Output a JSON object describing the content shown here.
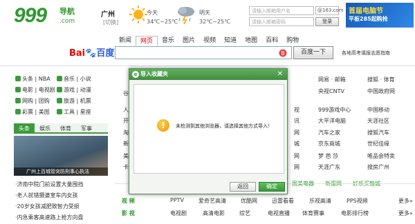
{
  "header": {
    "logo_number": "999",
    "logo_nav": "导航",
    "logo_com": ".com",
    "city": "广州",
    "city_switch": "[切换]",
    "weather": [
      {
        "day": "今天",
        "temp": "34℃~25℃"
      },
      {
        "day": "明天",
        "temp": "32℃~25℃"
      }
    ],
    "mail": {
      "user_placeholder": "请输入邮箱用户名",
      "domain": "@163.com",
      "password_placeholder": "请输入邮箱密码",
      "login_label": "登录"
    },
    "ad": {
      "line1": "首届电脑节",
      "line2": "平板285起购抢"
    }
  },
  "search": {
    "tabs": [
      "新闻",
      "网页",
      "音乐",
      "图片",
      "视频",
      "知道",
      "地图",
      "百科",
      "购物"
    ],
    "active_tab": "网页",
    "engine_bai": "Bai",
    "engine_du": "百度",
    "button_label": "百度一下",
    "side_link": "各地高考填报志愿指南"
  },
  "left": {
    "categories": [
      [
        "头条 | NBA",
        "音乐 | 小说"
      ],
      [
        "电影 | 电视剧",
        "游戏 | 动漫"
      ],
      [
        "网购 | 团购",
        "旅游 | 机票"
      ],
      [
        "彩票 | 美图",
        "工具 | 星座"
      ]
    ],
    "tabs": [
      "头条",
      "娱乐",
      "体育",
      "军事"
    ],
    "image_caption": "广州上百城管突防刑事心执法",
    "news": [
      "·济南中院门前设置大量围挡",
      "·老人就错摄婆室车内女孩",
      "·20岁女孩减肥致智力受损",
      "·内急乘客高速路上抢方向盘"
    ]
  },
  "sites": {
    "row1": [
      "网易 · 邮箱",
      "搜狐 · 体育"
    ],
    "row2": [
      "央视CNTV",
      "中国政府网"
    ],
    "col_a": [
      "999游戏中心",
      "大平洋电脑",
      "汽车之家",
      "京东商城",
      "梦 芭 莎",
      "天涯广东"
    ],
    "col_b": [
      "中国移动",
      "天涯社区",
      "搜狐汽车",
      "世纪佳缘",
      "唯品会特卖",
      "搜房广州"
    ],
    "col_left_edge": [
      "人",
      "开",
      "淘",
      "新",
      "美",
      "卡"
    ],
    "col_mid_edge": [
      "视",
      "讯",
      "网",
      "城",
      "网",
      "网"
    ],
    "strip": [
      "国美电器",
      "新蛋网",
      "好乐买鞋城"
    ],
    "video_row": {
      "label": "视  频",
      "items": [
        "PPTV",
        "爱奇艺高清",
        "优酷网",
        "迅雷看看",
        "乐视高清",
        "PPS视频"
      ],
      "more": "更多»"
    },
    "film_row": {
      "label": "影  视",
      "items": [
        "电视剧",
        "高清电影",
        "综艺",
        "电视直播",
        "体育赛事",
        "电影排行榜"
      ],
      "more": "更多»"
    }
  },
  "dialog": {
    "title": "导入收藏夹",
    "message": "未检测到其他浏览器，请选择其他方式导入！",
    "back_label": "返回",
    "ok_label": "确定"
  }
}
